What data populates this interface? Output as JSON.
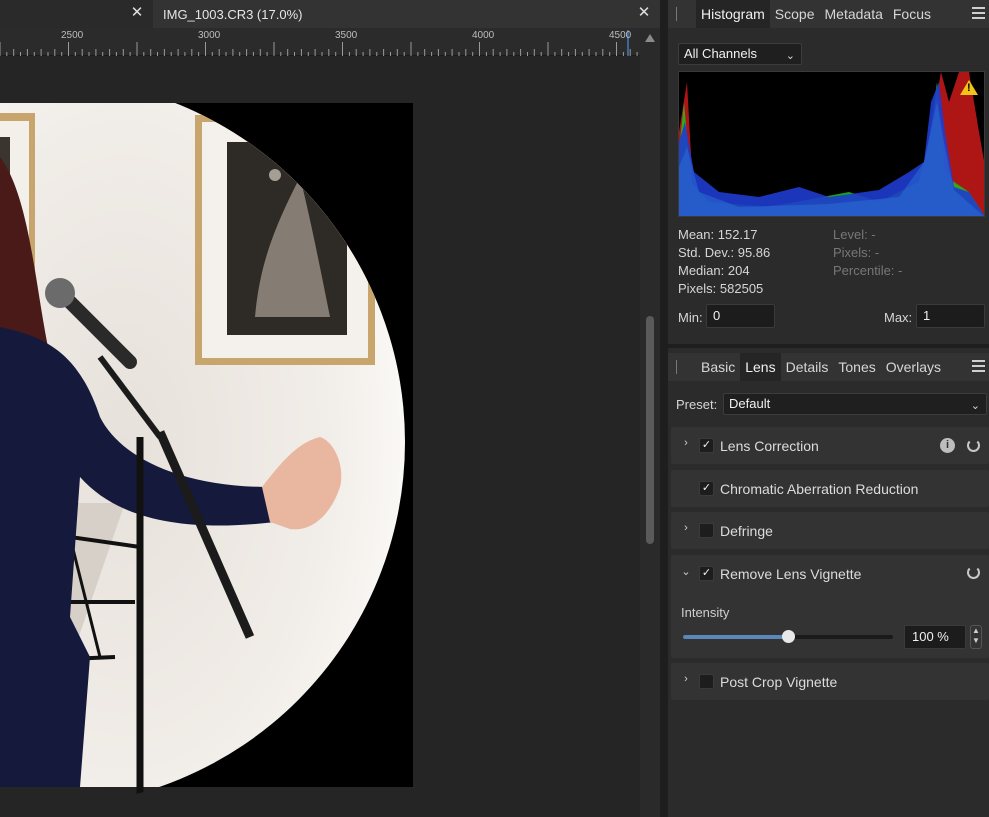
{
  "documents": {
    "tab_inactive": {
      "label": ""
    },
    "tab_active": {
      "label": "IMG_1003.CR3 (17.0%)"
    }
  },
  "ruler": {
    "labels": [
      "2500",
      "3000",
      "3500",
      "4000",
      "4500"
    ]
  },
  "histogram_panel": {
    "tabs": [
      "Histogram",
      "Scope",
      "Metadata",
      "Focus"
    ],
    "active_tab": "Histogram",
    "channel_select": "All Channels",
    "warning": "!",
    "stats_left": {
      "mean": "Mean: 152.17",
      "std_dev": "Std. Dev.: 95.86",
      "median": "Median: 204",
      "pixels": "Pixels: 582505"
    },
    "stats_right": {
      "level": "Level: -",
      "pixels": "Pixels: -",
      "percentile": "Percentile: -"
    },
    "min_label": "Min:",
    "min_value": "0",
    "max_label": "Max:",
    "max_value": "1"
  },
  "develop_panel": {
    "tabs": [
      "Basic",
      "Lens",
      "Details",
      "Tones",
      "Overlays"
    ],
    "active_tab": "Lens",
    "preset_label": "Preset:",
    "preset_value": "Default",
    "sections": {
      "lens_correction": {
        "label": "Lens Correction",
        "checked": true
      },
      "chromatic_aberration": {
        "label": "Chromatic Aberration Reduction",
        "checked": true
      },
      "defringe": {
        "label": "Defringe",
        "checked": false
      },
      "remove_lens_vignette": {
        "label": "Remove Lens Vignette",
        "checked": true,
        "intensity_label": "Intensity",
        "intensity_value": "100 %",
        "slider_fraction": 0.5
      },
      "post_crop_vignette": {
        "label": "Post Crop Vignette",
        "checked": false
      }
    }
  },
  "icons": {
    "check": "✓",
    "expanded": "⌄",
    "collapsed": "›",
    "close": "✕",
    "info": "i",
    "chevron_down": "⌄"
  }
}
